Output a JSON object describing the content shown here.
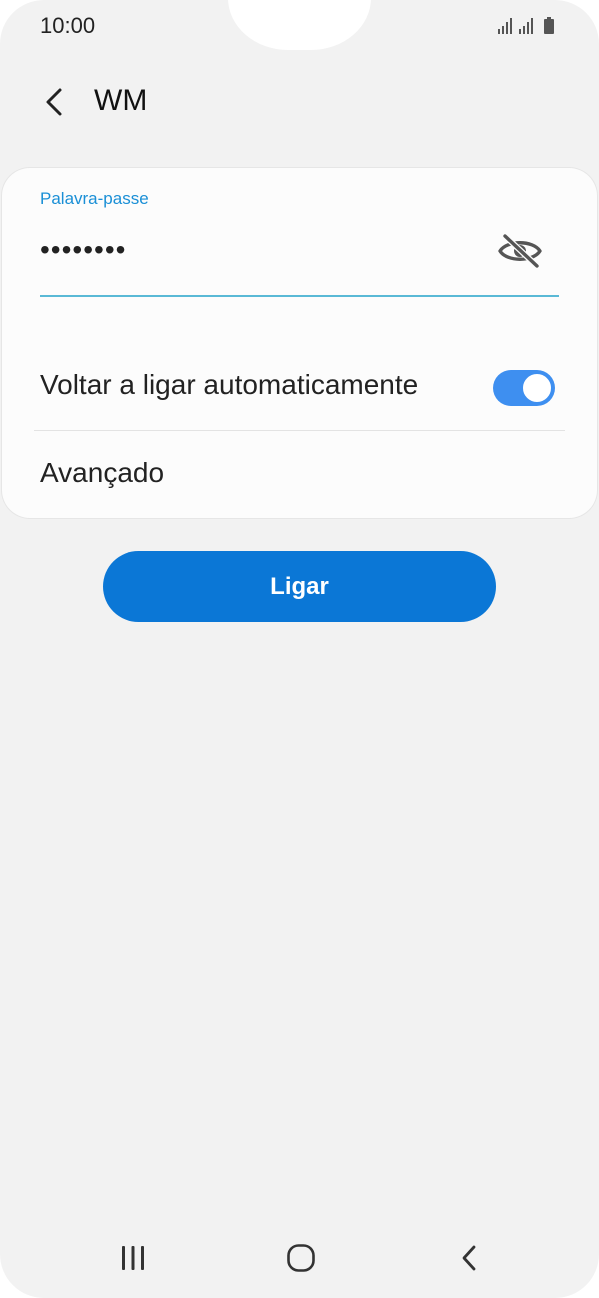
{
  "status_bar": {
    "time": "10:00",
    "icons": [
      "signal-icon",
      "signal-icon",
      "battery-icon"
    ]
  },
  "header": {
    "title": "WM",
    "back_icon": "chevron-left-icon"
  },
  "password_field": {
    "label": "Palavra-passe",
    "value": "••••••••",
    "toggle_icon": "eye-off-icon",
    "accent_color": "#1a8fd6"
  },
  "auto_reconnect": {
    "label": "Voltar a ligar automaticamente",
    "enabled": true,
    "toggle_color": "#3e8ff0"
  },
  "advanced": {
    "label": "Avançado"
  },
  "connect_button": {
    "label": "Ligar",
    "color": "#0b77d6"
  },
  "nav_bar": {
    "icons": [
      "recent-apps-icon",
      "home-icon",
      "back-icon"
    ]
  }
}
